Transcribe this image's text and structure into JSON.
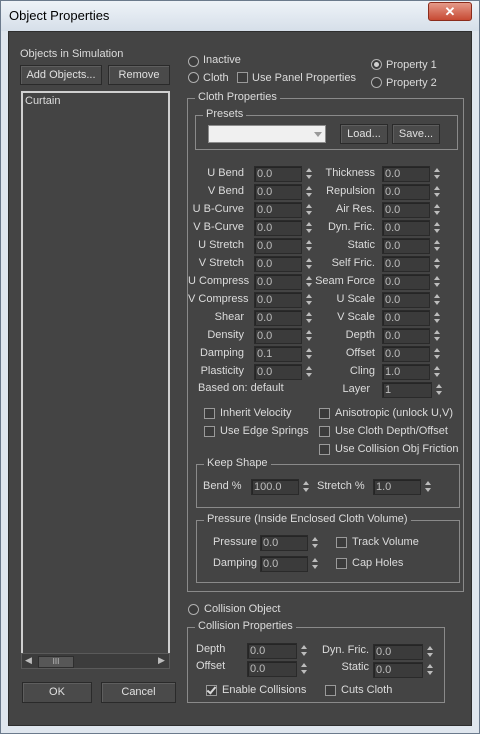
{
  "window": {
    "title": "Object Properties",
    "close_symbol": "✕"
  },
  "objects": {
    "header": "Objects in Simulation",
    "add_label": "Add Objects...",
    "remove_label": "Remove",
    "items": [
      "Curtain"
    ],
    "scroll_thumb_grip": "III"
  },
  "mode": {
    "inactive_label": "Inactive",
    "cloth_label": "Cloth",
    "cloth_selected": false,
    "use_panel_label": "Use Panel Properties",
    "property1_label": "Property 1",
    "property2_label": "Property 2",
    "property_selected": 1
  },
  "cloth": {
    "group_label": "Cloth Properties",
    "presets_label": "Presets",
    "presets_value": "",
    "load_label": "Load...",
    "save_label": "Save...",
    "left_params": [
      {
        "label": "U Bend",
        "value": "0.0"
      },
      {
        "label": "V Bend",
        "value": "0.0"
      },
      {
        "label": "U B-Curve",
        "value": "0.0"
      },
      {
        "label": "V B-Curve",
        "value": "0.0"
      },
      {
        "label": "U Stretch",
        "value": "0.0"
      },
      {
        "label": "V Stretch",
        "value": "0.0"
      },
      {
        "label": "U Compress",
        "value": "0.0"
      },
      {
        "label": "V Compress",
        "value": "0.0"
      },
      {
        "label": "Shear",
        "value": "0.0"
      },
      {
        "label": "Density",
        "value": "0.0"
      },
      {
        "label": "Damping",
        "value": "0.1"
      },
      {
        "label": "Plasticity",
        "value": "0.0"
      }
    ],
    "right_params": [
      {
        "label": "Thickness",
        "value": "0.0"
      },
      {
        "label": "Repulsion",
        "value": "0.0"
      },
      {
        "label": "Air Res.",
        "value": "0.0"
      },
      {
        "label": "Dyn. Fric.",
        "value": "0.0"
      },
      {
        "label": "Static",
        "value": "0.0"
      },
      {
        "label": "Self Fric.",
        "value": "0.0"
      },
      {
        "label": "Seam Force",
        "value": "0.0"
      },
      {
        "label": "U Scale",
        "value": "0.0"
      },
      {
        "label": "V Scale",
        "value": "0.0"
      },
      {
        "label": "Depth",
        "value": "0.0"
      },
      {
        "label": "Offset",
        "value": "0.0"
      },
      {
        "label": "Cling",
        "value": "1.0"
      }
    ],
    "based_on": "Based on: default",
    "layer_label": "Layer",
    "layer_value": "1",
    "checks": [
      {
        "label": "Inherit Velocity",
        "checked": false
      },
      {
        "label": "Use Edge Springs",
        "checked": false
      },
      {
        "label": "Anisotropic (unlock U,V)",
        "checked": false
      },
      {
        "label": "Use Cloth Depth/Offset",
        "checked": false
      },
      {
        "label": "Use Collision Obj Friction",
        "checked": false
      }
    ]
  },
  "keep_shape": {
    "group_label": "Keep Shape",
    "bend_label": "Bend %",
    "bend_value": "100.0",
    "stretch_label": "Stretch %",
    "stretch_value": "1.0"
  },
  "pressure": {
    "group_label": "Pressure (Inside Enclosed Cloth Volume)",
    "pressure_label": "Pressure",
    "pressure_value": "0.0",
    "damping_label": "Damping",
    "damping_value": "0.0",
    "track_volume_label": "Track Volume",
    "track_volume_checked": false,
    "cap_holes_label": "Cap Holes",
    "cap_holes_checked": false
  },
  "collision": {
    "object_label": "Collision Object",
    "group_label": "Collision Properties",
    "depth_label": "Depth",
    "depth_value": "0.0",
    "offset_label": "Offset",
    "offset_value": "0.0",
    "dyn_fric_label": "Dyn. Fric.",
    "dyn_fric_value": "0.0",
    "static_label": "Static",
    "static_value": "0.0",
    "enable_label": "Enable Collisions",
    "enable_checked": true,
    "cuts_label": "Cuts Cloth",
    "cuts_checked": false
  },
  "footer": {
    "ok_label": "OK",
    "cancel_label": "Cancel"
  },
  "colors": {
    "panel_bg": "#444444",
    "field_bg": "#3b3b3b",
    "text": "#dcdcdc"
  }
}
